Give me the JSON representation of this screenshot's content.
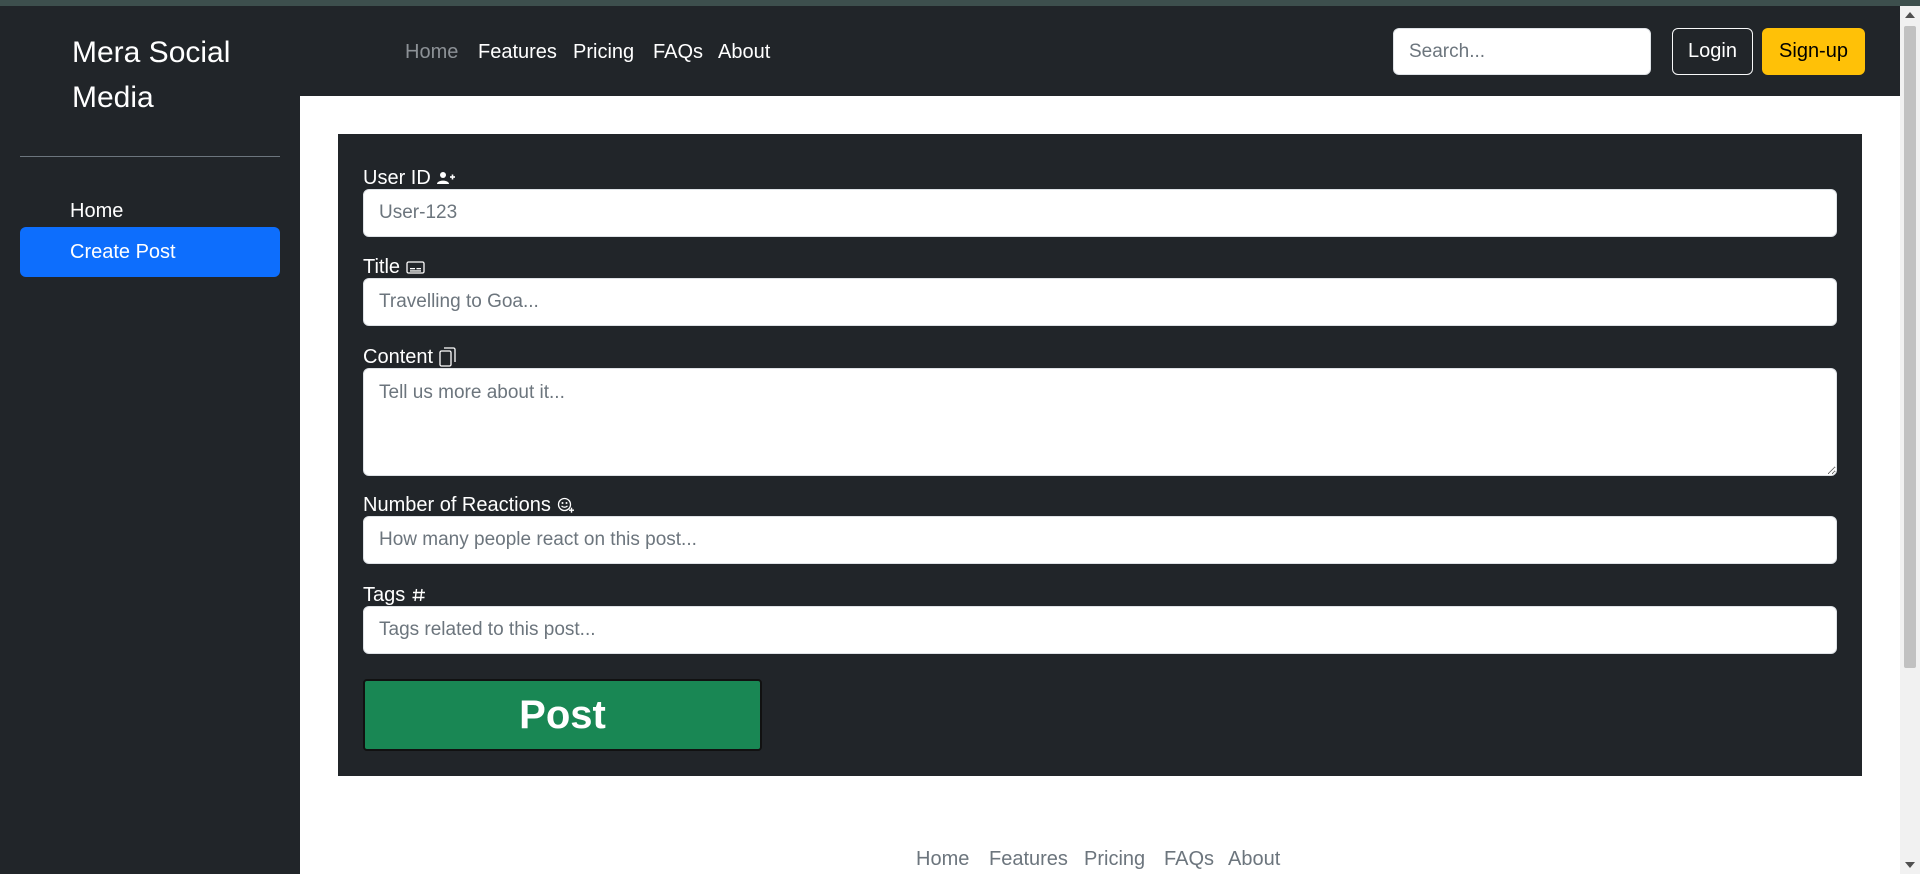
{
  "brand": {
    "name": "Mera Social Media"
  },
  "sidebar": {
    "items": [
      {
        "label": "Home",
        "active": false
      },
      {
        "label": "Create Post",
        "active": true
      }
    ]
  },
  "header": {
    "nav": [
      "Home",
      "Features",
      "Pricing",
      "FAQs",
      "About"
    ],
    "active_nav": "Home",
    "search_placeholder": "Search...",
    "login_label": "Login",
    "signup_label": "Sign-up"
  },
  "form": {
    "user_id": {
      "label": "User ID",
      "placeholder": "User-123",
      "icon": "person-plus-icon"
    },
    "title": {
      "label": "Title",
      "placeholder": "Travelling to Goa...",
      "icon": "subtitles-icon"
    },
    "content": {
      "label": "Content",
      "placeholder": "Tell us more about it...",
      "icon": "files-icon"
    },
    "reactions": {
      "label": "Number of Reactions",
      "placeholder": "How many people react on this post...",
      "icon": "emoji-plus-icon"
    },
    "tags": {
      "label": "Tags",
      "placeholder": "Tags related to this post...",
      "icon": "hash-icon"
    },
    "submit_label": "Post"
  },
  "footer": {
    "links": [
      "Home",
      "Features",
      "Pricing",
      "FAQs",
      "About"
    ]
  },
  "colors": {
    "dark": "#212529",
    "primary": "#0d6efd",
    "warning": "#ffc107",
    "success": "#198754"
  }
}
